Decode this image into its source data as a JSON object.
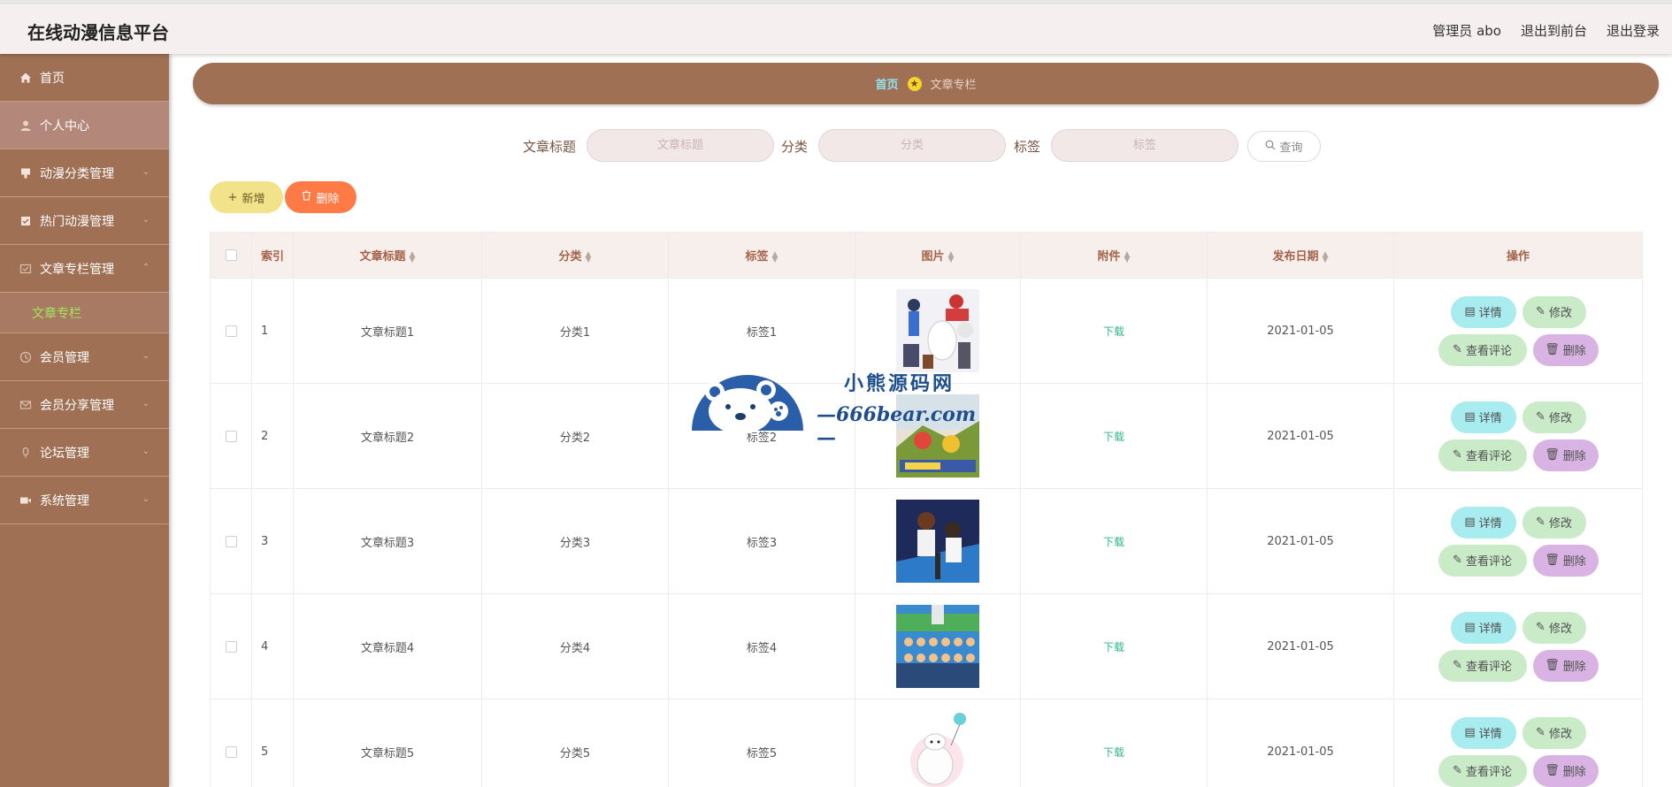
{
  "app": {
    "title": "在线动漫信息平台"
  },
  "header": {
    "user_label": "管理员 abo",
    "to_front": "退出到前台",
    "logout": "退出登录"
  },
  "sidebar": {
    "items": [
      {
        "label": "首页",
        "icon": "home-icon"
      },
      {
        "label": "个人中心",
        "icon": "user-icon",
        "active": true
      },
      {
        "label": "动漫分类管理",
        "icon": "tag-icon"
      },
      {
        "label": "热门动漫管理",
        "icon": "doc-icon"
      },
      {
        "label": "文章专栏管理",
        "icon": "article-icon",
        "expanded": true
      },
      {
        "label": "会员管理",
        "icon": "member-icon"
      },
      {
        "label": "会员分享管理",
        "icon": "mail-icon"
      },
      {
        "label": "论坛管理",
        "icon": "forum-icon"
      },
      {
        "label": "系统管理",
        "icon": "video-icon"
      }
    ],
    "sub_item": "文章专栏"
  },
  "breadcrumb": {
    "home": "首页",
    "current": "文章专栏"
  },
  "search": {
    "title_label": "文章标题",
    "title_placeholder": "文章标题",
    "category_label": "分类",
    "category_placeholder": "分类",
    "tag_label": "标签",
    "tag_placeholder": "标签",
    "query_button": "查询"
  },
  "actions": {
    "add": "新增",
    "delete": "删除"
  },
  "table": {
    "columns": [
      "索引",
      "文章标题",
      "分类",
      "标签",
      "图片",
      "附件",
      "发布日期",
      "操作"
    ],
    "rows": [
      {
        "index": "1",
        "title": "文章标题1",
        "category": "分类1",
        "tag": "标签1",
        "attachment": "下载",
        "date": "2021-01-05"
      },
      {
        "index": "2",
        "title": "文章标题2",
        "category": "分类2",
        "tag": "标签2",
        "attachment": "下载",
        "date": "2021-01-05"
      },
      {
        "index": "3",
        "title": "文章标题3",
        "category": "分类3",
        "tag": "标签3",
        "attachment": "下载",
        "date": "2021-01-05"
      },
      {
        "index": "4",
        "title": "文章标题4",
        "category": "分类4",
        "tag": "标签4",
        "attachment": "下载",
        "date": "2021-01-05"
      },
      {
        "index": "5",
        "title": "文章标题5",
        "category": "分类5",
        "tag": "标签5",
        "attachment": "下载",
        "date": "2021-01-05"
      }
    ],
    "row_actions": {
      "detail": "详情",
      "edit": "修改",
      "comments": "查看评论",
      "delete": "删除"
    }
  },
  "watermark": {
    "line1": "小熊源码网",
    "line2": "—666bear.com—"
  },
  "colors": {
    "sidebar": "#a07055",
    "topbar": "#f5eff0",
    "active_sub": "#a5e65a",
    "danger": "#ff7a45",
    "add": "#f2e38a"
  }
}
